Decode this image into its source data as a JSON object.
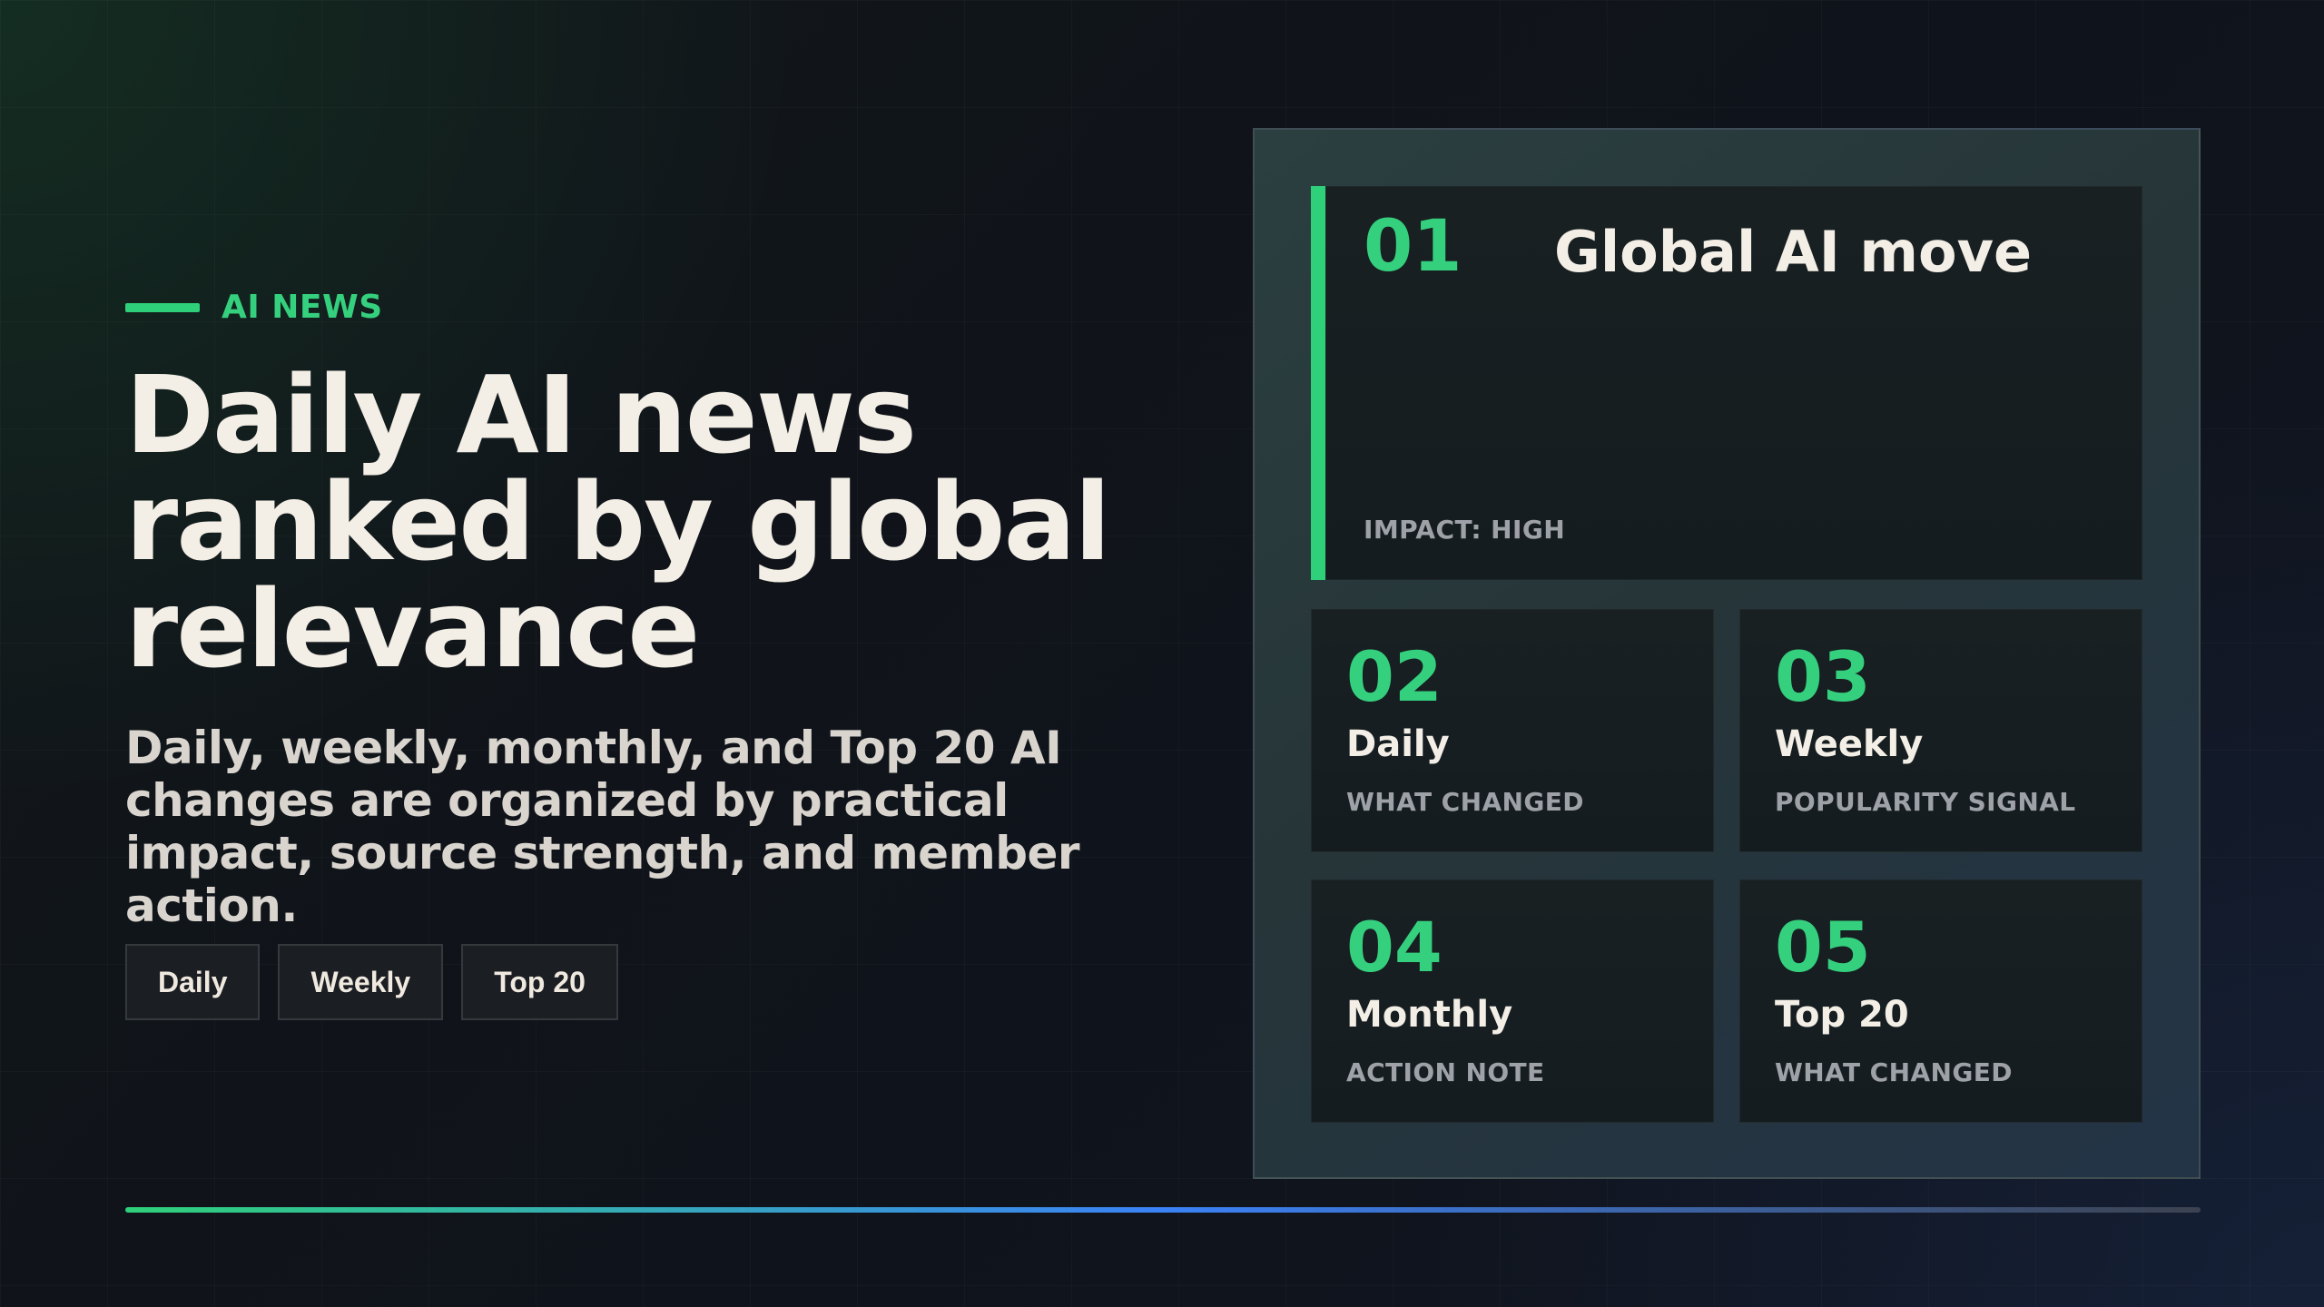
{
  "eyebrow": {
    "label": "AI NEWS"
  },
  "hero": {
    "title": "Daily AI news ranked by global relevance",
    "description": "Daily, weekly, monthly, and Top 20 AI changes are organized by practical impact, source strength, and member action."
  },
  "chips": [
    {
      "label": "Daily"
    },
    {
      "label": "Weekly"
    },
    {
      "label": "Top 20"
    }
  ],
  "featured": {
    "rank": "01",
    "title": "Global AI move",
    "impact": "IMPACT: HIGH"
  },
  "cards": [
    {
      "rank": "02",
      "title": "Daily",
      "subtitle": "WHAT CHANGED"
    },
    {
      "rank": "03",
      "title": "Weekly",
      "subtitle": "POPULARITY SIGNAL"
    },
    {
      "rank": "04",
      "title": "Monthly",
      "subtitle": "ACTION NOTE"
    },
    {
      "rank": "05",
      "title": "Top 20",
      "subtitle": "WHAT CHANGED"
    }
  ],
  "colors": {
    "accent": "#2fd07a",
    "accent_text": "#35d07e",
    "text_primary": "#f4efe6",
    "text_secondary": "#d9d5ce",
    "text_muted": "#9ea2a8",
    "background": "#0f131a",
    "panel": "#2a3b3e",
    "card": "#162022",
    "rule_mid": "#3b82f6"
  }
}
